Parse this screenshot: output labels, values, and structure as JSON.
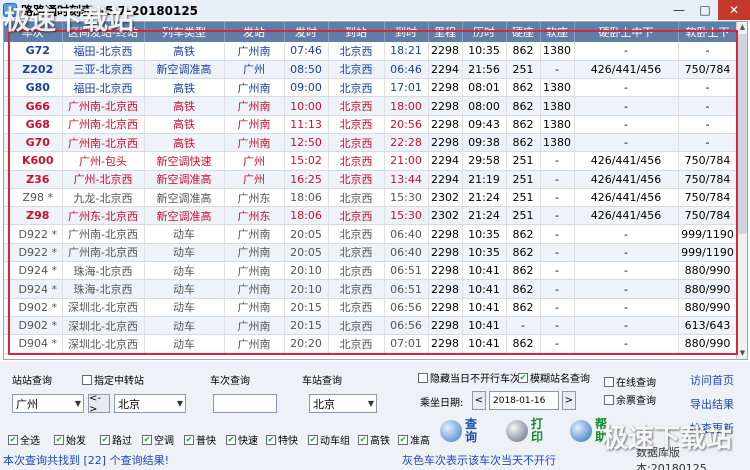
{
  "window": {
    "title": "路路通时刻表 v5.7-20180125",
    "minimize": "—",
    "maximize": "□",
    "close": "✕"
  },
  "watermark": {
    "text": "极速下载站"
  },
  "grid": {
    "columns": [
      "车次",
      "区间发站-终站",
      "列车类型",
      "发站",
      "发时",
      "到站",
      "到时",
      "里程",
      "历时",
      "硬座",
      "软座",
      "硬卧上中下",
      "软卧上下"
    ],
    "rows": [
      {
        "train": "G72",
        "section": "福田-北京西",
        "type": "高铁",
        "from": "广州南",
        "dep": "07:46",
        "to": "北京西",
        "arr": "18:21",
        "km": "2298",
        "dur": "10:35",
        "hard_seat": "862",
        "soft_seat": "1380",
        "hard_sleeper": "-",
        "soft_sleeper": "-",
        "color": "#1b3fa0"
      },
      {
        "train": "Z202",
        "section": "三亚-北京西",
        "type": "新空调准高",
        "from": "广州",
        "dep": "08:50",
        "to": "北京西",
        "arr": "06:46",
        "km": "2294",
        "dur": "21:56",
        "hard_seat": "251",
        "soft_seat": "-",
        "hard_sleeper": "426/441/456",
        "soft_sleeper": "750/784",
        "color": "#1b3fa0"
      },
      {
        "train": "G80",
        "section": "福田-北京西",
        "type": "高铁",
        "from": "广州南",
        "dep": "09:00",
        "to": "北京西",
        "arr": "17:01",
        "km": "2298",
        "dur": "08:01",
        "hard_seat": "862",
        "soft_seat": "1380",
        "hard_sleeper": "-",
        "soft_sleeper": "-",
        "color": "#1b3fa0"
      },
      {
        "train": "G66",
        "section": "广州南-北京西",
        "type": "高铁",
        "from": "广州南",
        "dep": "10:00",
        "to": "北京西",
        "arr": "18:00",
        "km": "2298",
        "dur": "08:00",
        "hard_seat": "862",
        "soft_seat": "1380",
        "hard_sleeper": "-",
        "soft_sleeper": "-",
        "color": "#c8102e"
      },
      {
        "train": "G68",
        "section": "广州南-北京西",
        "type": "高铁",
        "from": "广州南",
        "dep": "11:13",
        "to": "北京西",
        "arr": "20:56",
        "km": "2298",
        "dur": "09:43",
        "hard_seat": "862",
        "soft_seat": "1380",
        "hard_sleeper": "-",
        "soft_sleeper": "-",
        "color": "#c8102e"
      },
      {
        "train": "G70",
        "section": "广州南-北京西",
        "type": "高铁",
        "from": "广州南",
        "dep": "12:50",
        "to": "北京西",
        "arr": "22:28",
        "km": "2298",
        "dur": "09:38",
        "hard_seat": "862",
        "soft_seat": "1380",
        "hard_sleeper": "-",
        "soft_sleeper": "-",
        "color": "#c8102e"
      },
      {
        "train": "K600",
        "section": "广州-包头",
        "type": "新空调快速",
        "from": "广州",
        "dep": "15:02",
        "to": "北京西",
        "arr": "21:00",
        "km": "2294",
        "dur": "29:58",
        "hard_seat": "251",
        "soft_seat": "-",
        "hard_sleeper": "426/441/456",
        "soft_sleeper": "750/784",
        "color": "#c8102e"
      },
      {
        "train": "Z36",
        "section": "广州-北京西",
        "type": "新空调准高",
        "from": "广州",
        "dep": "16:25",
        "to": "北京西",
        "arr": "13:44",
        "km": "2294",
        "dur": "21:19",
        "hard_seat": "251",
        "soft_seat": "-",
        "hard_sleeper": "426/441/456",
        "soft_sleeper": "750/784",
        "color": "#c8102e"
      },
      {
        "train": "Z98 *",
        "section": "九龙-北京西",
        "type": "新空调准高",
        "from": "广州东",
        "dep": "18:06",
        "to": "北京西",
        "arr": "15:30",
        "km": "2302",
        "dur": "21:24",
        "hard_seat": "251",
        "soft_seat": "-",
        "hard_sleeper": "426/441/456",
        "soft_sleeper": "750/784",
        "color": "#555555"
      },
      {
        "train": "Z98",
        "section": "广州东-北京西",
        "type": "新空调准高",
        "from": "广州东",
        "dep": "18:06",
        "to": "北京西",
        "arr": "15:30",
        "km": "2302",
        "dur": "21:24",
        "hard_seat": "251",
        "soft_seat": "-",
        "hard_sleeper": "426/441/456",
        "soft_sleeper": "750/784",
        "color": "#c8102e"
      },
      {
        "train": "D922 *",
        "section": "广州南-北京西",
        "type": "动车",
        "from": "广州南",
        "dep": "20:05",
        "to": "北京西",
        "arr": "06:40",
        "km": "2298",
        "dur": "10:35",
        "hard_seat": "862",
        "soft_seat": "-",
        "hard_sleeper": "-",
        "soft_sleeper": "999/1190",
        "color": "#555555"
      },
      {
        "train": "D922 *",
        "section": "广州南-北京西",
        "type": "动车",
        "from": "广州南",
        "dep": "20:05",
        "to": "北京西",
        "arr": "06:40",
        "km": "2298",
        "dur": "10:35",
        "hard_seat": "862",
        "soft_seat": "-",
        "hard_sleeper": "-",
        "soft_sleeper": "999/1190",
        "color": "#555555"
      },
      {
        "train": "D924 *",
        "section": "珠海-北京西",
        "type": "动车",
        "from": "广州南",
        "dep": "20:10",
        "to": "北京西",
        "arr": "06:51",
        "km": "2298",
        "dur": "10:41",
        "hard_seat": "862",
        "soft_seat": "-",
        "hard_sleeper": "-",
        "soft_sleeper": "880/990",
        "color": "#555555"
      },
      {
        "train": "D924 *",
        "section": "珠海-北京西",
        "type": "动车",
        "from": "广州南",
        "dep": "20:10",
        "to": "北京西",
        "arr": "06:51",
        "km": "2298",
        "dur": "10:41",
        "hard_seat": "862",
        "soft_seat": "-",
        "hard_sleeper": "-",
        "soft_sleeper": "880/990",
        "color": "#555555"
      },
      {
        "train": "D902 *",
        "section": "深圳北-北京西",
        "type": "动车",
        "from": "广州南",
        "dep": "20:15",
        "to": "北京西",
        "arr": "06:56",
        "km": "2298",
        "dur": "10:41",
        "hard_seat": "862",
        "soft_seat": "-",
        "hard_sleeper": "-",
        "soft_sleeper": "880/990",
        "color": "#555555"
      },
      {
        "train": "D902 *",
        "section": "深圳北-北京西",
        "type": "动车",
        "from": "广州南",
        "dep": "20:15",
        "to": "北京西",
        "arr": "06:56",
        "km": "2298",
        "dur": "10:41",
        "hard_seat": "-",
        "soft_seat": "-",
        "hard_sleeper": "-",
        "soft_sleeper": "613/643",
        "color": "#555555"
      },
      {
        "train": "D904 *",
        "section": "深圳北-北京西",
        "type": "动车",
        "from": "广州南",
        "dep": "20:20",
        "to": "北京西",
        "arr": "07:01",
        "km": "2298",
        "dur": "10:41",
        "hard_seat": "862",
        "soft_seat": "-",
        "hard_sleeper": "-",
        "soft_sleeper": "880/990",
        "color": "#555555"
      }
    ]
  },
  "panel": {
    "station_query_label": "站站查询",
    "transfer_label": "指定中转站",
    "from_station": "广州",
    "swap_label": "<->",
    "to_station": "北京",
    "train_query_label": "车次查询",
    "train_input": "",
    "station_query2_label": "车站查询",
    "station2": "北京",
    "hide_label": "隐藏当日不开行车次",
    "fuzzy_label": "模糊站名查询",
    "date_label": "乘坐日期:",
    "prev": "<",
    "date": "2018-01-16",
    "next": ">",
    "online_label": "在线查询",
    "ticket_label": "余票查询",
    "home_link": "访问首页",
    "export_link": "导出结果",
    "update_link": "检查更新",
    "query_btn": "查询",
    "print_btn": "打印",
    "help_btn": "帮助",
    "filters": [
      {
        "label": "全选",
        "checked": true
      },
      {
        "label": "始发",
        "checked": true
      },
      {
        "label": "路过",
        "checked": true
      },
      {
        "label": "空调",
        "checked": true
      },
      {
        "label": "普快",
        "checked": true
      },
      {
        "label": "快速",
        "checked": true
      },
      {
        "label": "特快",
        "checked": true
      },
      {
        "label": "动车组",
        "checked": true
      },
      {
        "label": "高铁",
        "checked": true
      },
      {
        "label": "准高",
        "checked": true
      }
    ]
  },
  "status": {
    "left": "本次查询共找到 [22] 个查询结果!",
    "mid": "灰色车次表示该车次当天不开行",
    "right": "数据库版本:20180125"
  }
}
